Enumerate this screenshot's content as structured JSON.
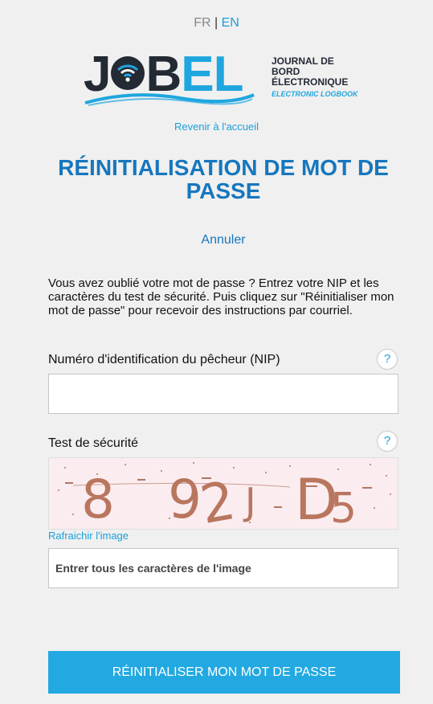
{
  "lang": {
    "fr": "FR",
    "separator": "|",
    "en": "EN"
  },
  "logo": {
    "word_start": "J",
    "word_mid": "B",
    "word_end": "EL",
    "tagline_line1": "JOURNAL DE BORD",
    "tagline_line2": "ÉLECTRONIQUE",
    "tagline_line3": "ELECTRONIC LOGBOOK"
  },
  "nav": {
    "back_link": "Revenir à l'accueil"
  },
  "page": {
    "title": "RÉINITIALISATION DE MOT DE PASSE",
    "cancel": "Annuler"
  },
  "instructions": "Vous avez oublié votre mot de passe ? Entrez votre NIP et les caractères du test de sécurité. Puis cliquez sur \"Réinitialiser mon mot de passe\" pour recevoir des instructions par courriel.",
  "form": {
    "nip_label": "Numéro d'identification du pêcheur (NIP)",
    "nip_value": "",
    "security_label": "Test de sécurité",
    "help_glyph": "?",
    "captcha_chars": [
      "8",
      "9",
      "2",
      "J",
      "D",
      "5"
    ],
    "refresh_link": "Rafraichir l'image",
    "captcha_placeholder": "Entrer tous les caractères de l'image",
    "submit_label": "RÉINITIALISER MON MOT DE PASSE"
  },
  "colors": {
    "accent": "#1a9fd9",
    "title": "#1677be",
    "button": "#22a9e1",
    "background": "#f0f0f0",
    "logo_dark": "#232a34"
  }
}
